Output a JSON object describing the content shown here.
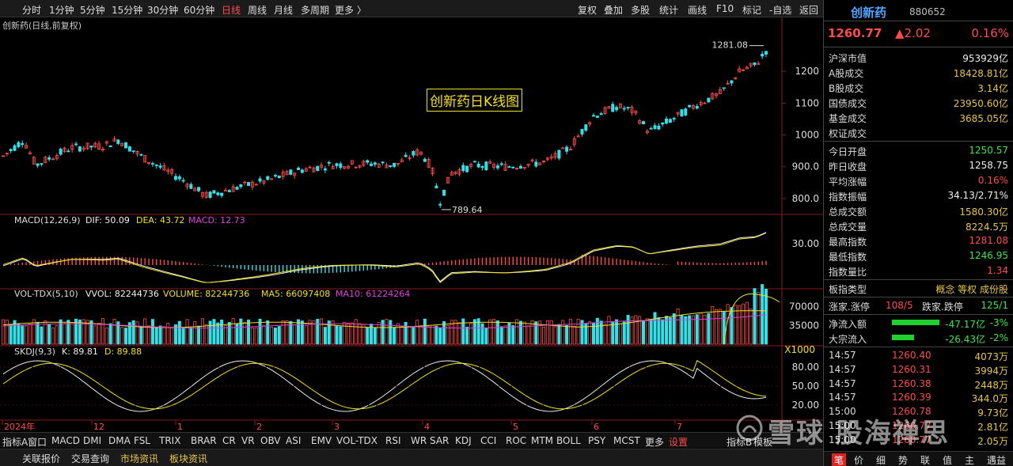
{
  "toolbar": {
    "periods": [
      "分时",
      "1分钟",
      "5分钟",
      "15分钟",
      "30分钟",
      "60分钟",
      "日线",
      "周线",
      "月线",
      "多周期",
      "更多 〉"
    ],
    "active": "日线",
    "actions": [
      "复权",
      "叠加",
      "多股",
      "统计",
      "画线",
      "F10",
      "标记",
      "-自选",
      "返回"
    ]
  },
  "chart": {
    "title": "创新药(日线,前复权)",
    "annotation": "创新药日K线图",
    "high_label": "1281.08",
    "low_label": "789.64",
    "price_axis": [
      "1200",
      "1100",
      "1000",
      "900.0",
      "800.0"
    ],
    "macd_axis": "30.00",
    "vol_axis": [
      "70000",
      "35000",
      "X1000"
    ],
    "kdj_axis": [
      "80.00",
      "50.00",
      "20.00"
    ],
    "date_labels": [
      "2024年",
      "12",
      "1",
      "2",
      "3",
      "4",
      "5",
      "6",
      "7"
    ]
  },
  "macd": {
    "name": "MACD(12,26,9)",
    "dif": "DIF: 50.09",
    "dea": "DEA: 43.72",
    "macd": "MACD: 12.73"
  },
  "vol": {
    "name": "VOL-TDX(5,10)",
    "vvol": "VVOL: 82244736",
    "volume": "VOLUME: 82244736",
    "ma5": "MA5: 66097408",
    "ma10": "MA10: 61224264"
  },
  "kdj": {
    "name": "SKDJ(9,3)",
    "k": "K: 89.81",
    "d": "D: 89.88"
  },
  "indicators": [
    "指标A",
    "窗口",
    "MACD",
    "DMI",
    "DMA",
    "FSL",
    "TRIX",
    "BRAR",
    "CR",
    "VR",
    "OBV",
    "ASI",
    "EMV",
    "VOL-TDX",
    "RSI",
    "WR",
    "SAR",
    "KDJ",
    "CCI",
    "ROC",
    "MTM",
    "BOLL",
    "PSY",
    "MCST",
    "更多",
    "设置"
  ],
  "indicator_extra": [
    "指标B",
    "模板"
  ],
  "status_tabs": [
    "关联报价",
    "交易查询",
    "市场资讯",
    "板块资讯"
  ],
  "quote": {
    "name": "创新药",
    "code": "880652",
    "price": "1260.77",
    "change": "▲2.02",
    "pct": "0.16%"
  },
  "stats": [
    {
      "k": "沪深市值",
      "v": "953929亿",
      "c": "wht"
    },
    {
      "k": "A股成交",
      "v": "18428.81亿",
      "c": "yel"
    },
    {
      "k": "B股成交",
      "v": "3.14亿",
      "c": "yel"
    },
    {
      "k": "国债成交",
      "v": "23950.60亿",
      "c": "yel"
    },
    {
      "k": "基金成交",
      "v": "3685.05亿",
      "c": "yel"
    },
    {
      "k": "权证成交",
      "v": "",
      "c": "yel"
    }
  ],
  "stats2": [
    {
      "k": "今日开盘",
      "v": "1250.57",
      "c": "grn"
    },
    {
      "k": "昨日收盘",
      "v": "1258.75",
      "c": "wht"
    },
    {
      "k": "平均涨幅",
      "v": "0.16%",
      "c": "red"
    },
    {
      "k": "指数振幅",
      "v": "34.13/2.71%",
      "c": "wht"
    },
    {
      "k": "总成交额",
      "v": "1580.30亿",
      "c": "yel"
    },
    {
      "k": "总成交量",
      "v": "8224.5万",
      "c": "yel"
    },
    {
      "k": "最高指数",
      "v": "1281.08",
      "c": "red"
    },
    {
      "k": "最低指数",
      "v": "1246.95",
      "c": "grn"
    },
    {
      "k": "指数量比",
      "v": "1.34",
      "c": "red"
    }
  ],
  "board": {
    "k": "板指类型",
    "v": "概念 等权 成份股"
  },
  "updown": {
    "k1": "涨家.涨停",
    "v1": "108/5",
    "k2": "跌家.跌停",
    "v2": "125/1"
  },
  "flows": [
    {
      "k": "净流入额",
      "v": "-47.17亿",
      "p": "-3%",
      "bar": 0.75
    },
    {
      "k": "大宗流入",
      "v": "-26.43亿",
      "p": "-2%",
      "bar": 0.35
    }
  ],
  "ticks": [
    {
      "t": "14:57",
      "p": "1260.40",
      "v": "4073万"
    },
    {
      "t": "14:57",
      "p": "1260.31",
      "v": "3994万"
    },
    {
      "t": "14:57",
      "p": "1260.38",
      "v": "2448万"
    },
    {
      "t": "14:57",
      "p": "1260.39",
      "v": "344.0万"
    },
    {
      "t": "15:00",
      "p": "1260.78",
      "v": "9.73亿"
    },
    {
      "t": "15:00",
      "p": "1260.77",
      "v": "2.81亿"
    },
    {
      "t": "15:00",
      "p": "1260.77",
      "v": "2.05万"
    }
  ],
  "right_tabs": [
    "笔",
    "价",
    "细",
    "势",
    "联",
    "值",
    "主",
    "遇益"
  ],
  "watermark": "雪球  股海禅思",
  "colors": {
    "up": "#ff4b4b",
    "down": "#33e0e8",
    "yellow": "#f0e020",
    "magenta": "#e040e0"
  }
}
